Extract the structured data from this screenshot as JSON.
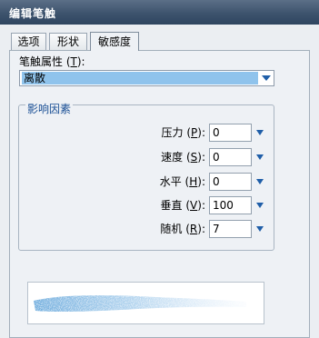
{
  "window": {
    "title": "编辑笔触"
  },
  "tabs": [
    {
      "label": "选项"
    },
    {
      "label": "形状"
    },
    {
      "label": "敏感度",
      "selected": true
    }
  ],
  "brush_property": {
    "label": "笔触属性",
    "hotkey": "T",
    "value": "离散"
  },
  "influence_group": {
    "title": "影响因素",
    "rows": [
      {
        "label": "压力",
        "hotkey": "P",
        "value": "0"
      },
      {
        "label": "速度",
        "hotkey": "S",
        "value": "0"
      },
      {
        "label": "水平",
        "hotkey": "H",
        "value": "0"
      },
      {
        "label": "垂直",
        "hotkey": "V",
        "value": "100"
      },
      {
        "label": "随机",
        "hotkey": "R",
        "value": "7"
      }
    ]
  },
  "colors": {
    "title_bar": "#3d536d",
    "selection": "#8fc3ec",
    "accent_arrow": "#1f5ea8",
    "group_title": "#1a4f95"
  },
  "icons": {
    "dropdown": "chevron-down-icon",
    "stepper": "triangle-down-icon"
  }
}
